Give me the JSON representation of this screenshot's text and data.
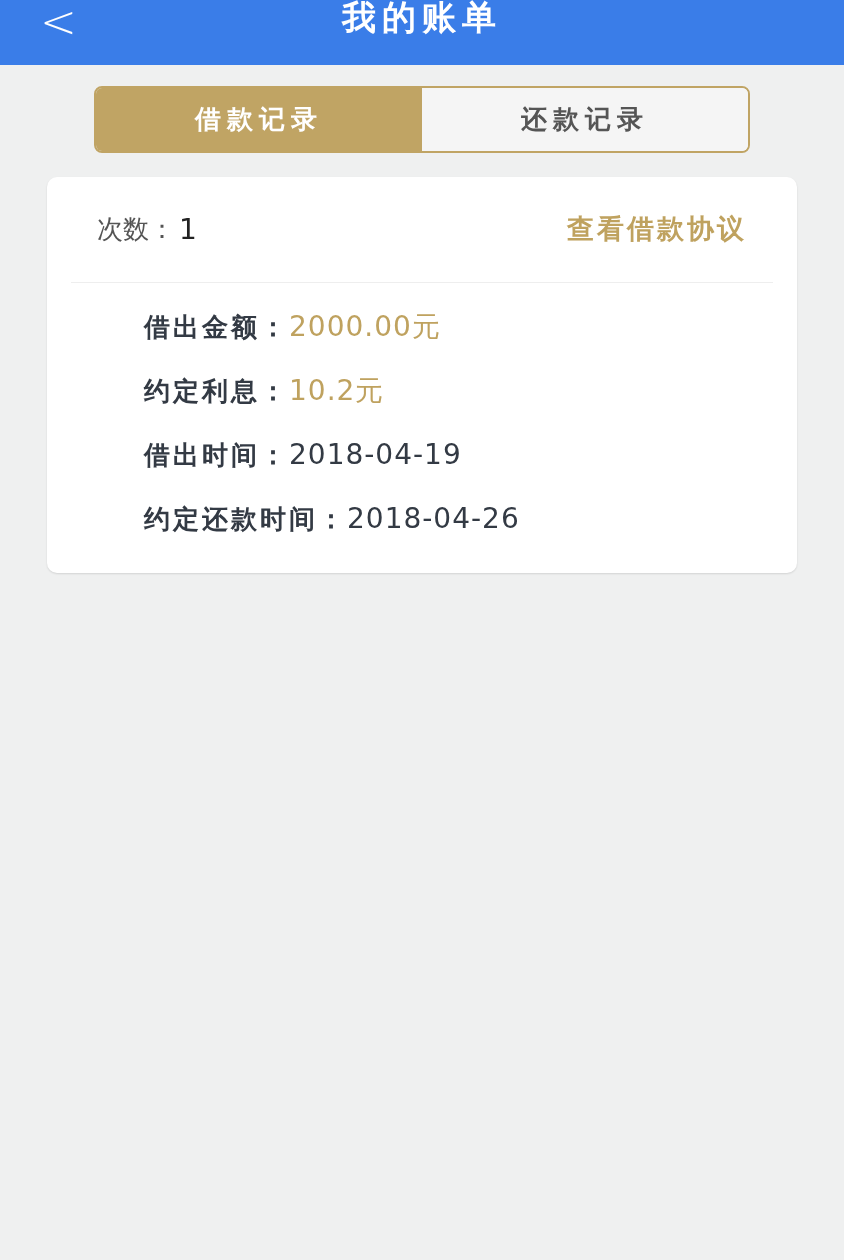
{
  "header": {
    "back": "<",
    "title": "我的账单"
  },
  "tabs": [
    {
      "label": "借款记录",
      "selected": true
    },
    {
      "label": "还款记录",
      "selected": false
    }
  ],
  "card": {
    "count_label": "次数：",
    "count": "1",
    "link": "查看借款协议",
    "rows": [
      {
        "label": "借出金额：",
        "value": "2000.00元",
        "kind": "money"
      },
      {
        "label": "约定利息：",
        "value": "10.2元",
        "kind": "money"
      },
      {
        "label": "借出时间：",
        "value": "2018-04-19",
        "kind": "date"
      },
      {
        "label": "约定还款时间：",
        "value": "2018-04-26",
        "kind": "date"
      }
    ]
  }
}
